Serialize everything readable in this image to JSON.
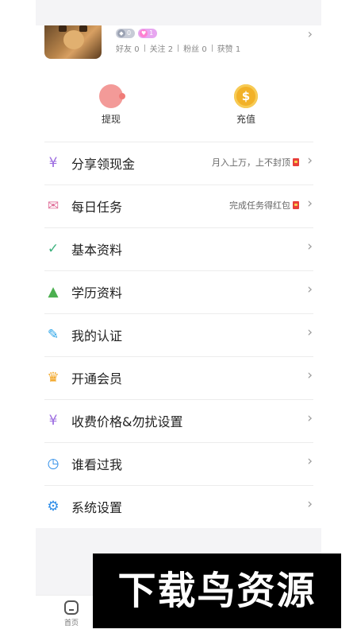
{
  "profile": {
    "badges": [
      {
        "icon": "diamond-icon",
        "value": "0"
      },
      {
        "icon": "heart-icon",
        "value": "1"
      }
    ],
    "stats": [
      {
        "label": "好友",
        "value": "0"
      },
      {
        "label": "关注",
        "value": "2"
      },
      {
        "label": "粉丝",
        "value": "0"
      },
      {
        "label": "获赞",
        "value": "1"
      }
    ]
  },
  "actions": {
    "withdraw": {
      "label": "提现",
      "icon": "piggy-bank-icon"
    },
    "recharge": {
      "label": "充值",
      "icon": "coin-icon"
    }
  },
  "menu": [
    {
      "label": "分享领现金",
      "icon": "money-bag-icon",
      "note": "月入上万，上不封顶",
      "color": "#9b6be0"
    },
    {
      "label": "每日任务",
      "icon": "envelope-icon",
      "note": "完成任务得红包",
      "color": "#e0709a"
    },
    {
      "label": "基本资料",
      "icon": "badge-check-icon",
      "note": "",
      "color": "#3fb27f"
    },
    {
      "label": "学历资料",
      "icon": "graduation-cap-icon",
      "note": "",
      "color": "#4caf50"
    },
    {
      "label": "我的认证",
      "icon": "edit-document-icon",
      "note": "",
      "color": "#2aa4e8"
    },
    {
      "label": "开通会员",
      "icon": "crown-icon",
      "note": "",
      "color": "#f2a31e"
    },
    {
      "label": "收费价格&勿扰设置",
      "icon": "money-bag-icon",
      "note": "",
      "color": "#9b6be0"
    },
    {
      "label": "谁看过我",
      "icon": "clock-user-icon",
      "note": "",
      "color": "#2a8be8"
    },
    {
      "label": "系统设置",
      "icon": "gear-icon",
      "note": "",
      "color": "#2a8be8"
    }
  ],
  "tabbar": {
    "home": {
      "label": "首页",
      "icon": "home-icon"
    }
  },
  "watermark": {
    "text": "下载鸟资源"
  }
}
